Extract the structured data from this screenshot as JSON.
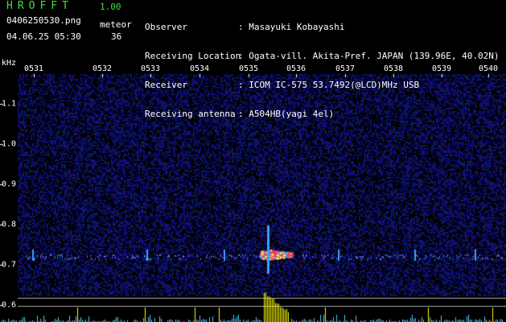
{
  "app": {
    "title": "HROFFT",
    "version": "1.00"
  },
  "file": {
    "name": "0406250530.png",
    "datetime": "04.06.25 05:30"
  },
  "mode": "meteor",
  "count": "36",
  "meta": [
    {
      "label": "Observer",
      "value": ": Masayuki Kobayashi"
    },
    {
      "label": "Receiving Location",
      "value": ": Ogata-vill. Akita-Pref. JAPAN (139.96E, 40.02N)"
    },
    {
      "label": "Receiver",
      "value": ": ICOM IC-575 53.7492(@LCD)MHz USB"
    },
    {
      "label": "Receiving antenna",
      "value": ": A504HB(yagi 4el)"
    }
  ],
  "axis": {
    "unit": "kHz",
    "x_ticks": [
      "0531",
      "0532",
      "0533",
      "0534",
      "0535",
      "0536",
      "0537",
      "0538",
      "0539",
      "0540"
    ],
    "y_ticks": [
      "1.1",
      "1.0",
      "0.9",
      "0.8",
      "0.7",
      "0.6"
    ]
  },
  "colors": {
    "background": "#000000",
    "title": "#3fe03f",
    "noise": "#1a1a6e",
    "echo_band": "#3fa0ff",
    "echo_core": "#ff3060",
    "histogram": "#ffff00",
    "histogram_low": "#40d0ff"
  }
}
